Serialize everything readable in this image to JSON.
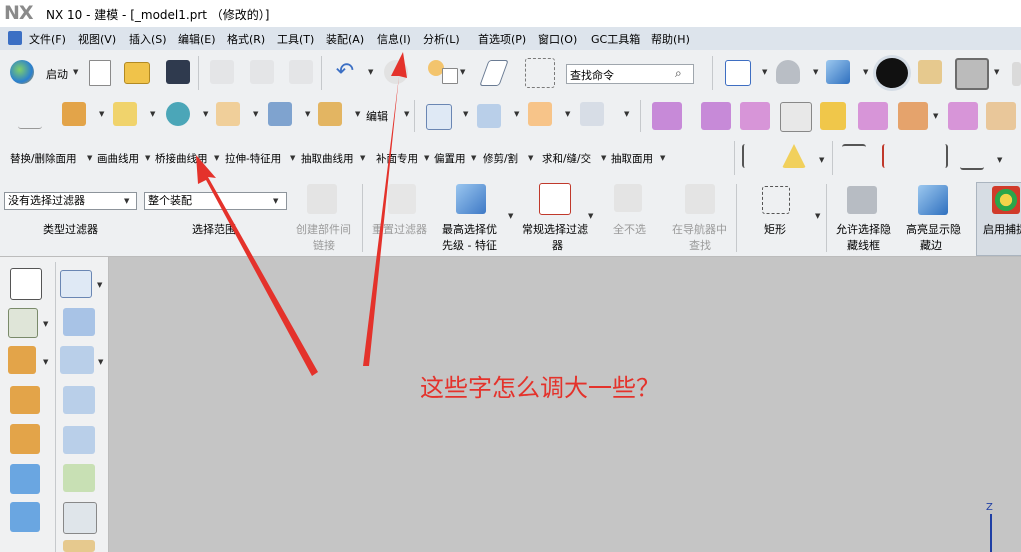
{
  "window": {
    "logo": "NX",
    "title": "NX 10 - 建模 - [_model1.prt （修改的）]"
  },
  "menubar": [
    "文件(F)",
    "视图(V)",
    "插入(S)",
    "编辑(E)",
    "格式(R)",
    "工具(T)",
    "装配(A)",
    "信息(I)",
    "分析(L)",
    "首选项(P)",
    "窗口(O)",
    "GC工具箱",
    "帮助(H)"
  ],
  "toolbar1": {
    "start_label": "启动",
    "search_placeholder": "查找命令"
  },
  "toolbar2": {
    "edit_label": "编辑"
  },
  "toolbar3": {
    "groups": [
      "替换/删除面用",
      "画曲线用",
      "桥接曲线用",
      "拉伸-特征用",
      "抽取曲线用",
      "补面专用",
      "偏置用",
      "修剪/割",
      "求和/缝/交",
      "抽取面用"
    ]
  },
  "selection_bar": {
    "type_filter_value": "没有选择过滤器",
    "type_filter_label": "类型过滤器",
    "scope_value": "整个装配",
    "scope_label": "选择范围",
    "create_link_label_1": "创建部件间",
    "create_link_label_2": "链接",
    "reset_filter_label": "重置过滤器",
    "priority_label_1": "最高选择优",
    "priority_label_2": "先级 - 特征",
    "general_filter_label_1": "常规选择过滤",
    "general_filter_label_2": "器",
    "deselect_all_label": "全不选",
    "find_in_navigator_label_1": "在导航器中",
    "find_in_navigator_label_2": "查找",
    "rectangle_label": "矩形",
    "allow_hidden_label_1": "允许选择隐",
    "allow_hidden_label_2": "藏线框",
    "highlight_hidden_label_1": "高亮显示隐",
    "highlight_hidden_label_2": "藏边",
    "enable_snap_label": "启用捕捉"
  },
  "annotation": {
    "question": "这些字怎么调大一些？",
    "color": "#e4322b"
  },
  "viewport": {
    "z_axis_label": "Z"
  }
}
